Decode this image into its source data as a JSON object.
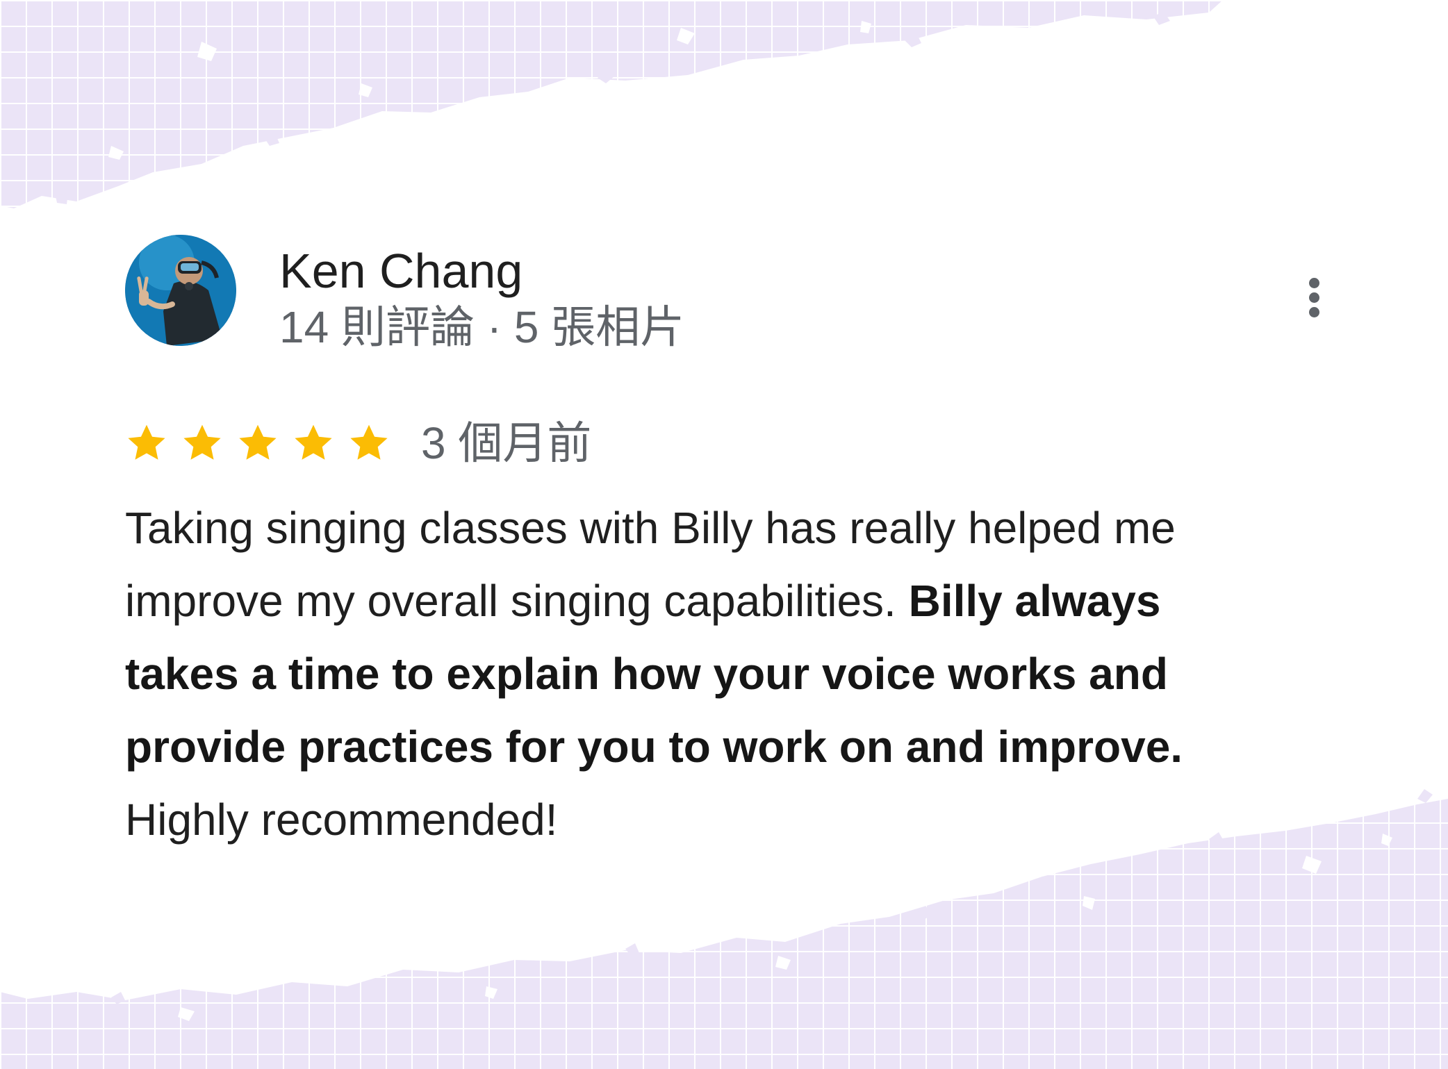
{
  "reviewer": {
    "name": "Ken Chang",
    "meta": "14 則評論 · 5 張相片"
  },
  "rating": {
    "stars": 5,
    "max": 5,
    "star_color": "#fbbc04",
    "date": "3 個月前"
  },
  "review": {
    "text_part1": "Taking singing classes with Billy has really helped me improve my overall singing capabilities. ",
    "text_bold": "Billy always takes a time to explain how your voice works and provide practices for you to work on and improve.",
    "text_part2": " Highly recommended!"
  },
  "menu": {
    "icon": "more-vertical-icon"
  },
  "colors": {
    "background": "#ffffff",
    "decor_fill": "#ece6f6",
    "decor_grid": "#ffffff",
    "meta_text": "#5f6368",
    "body_text": "#1f1f1f"
  }
}
